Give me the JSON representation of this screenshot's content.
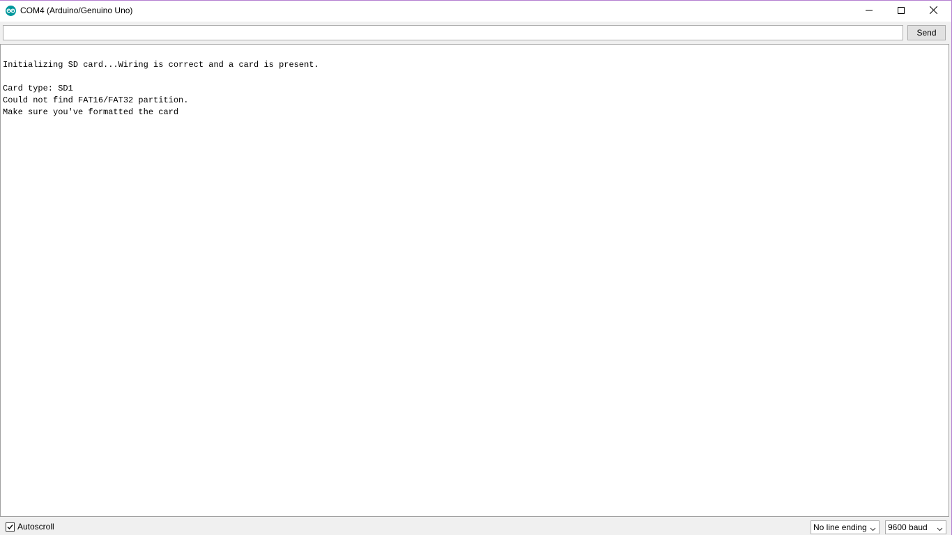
{
  "window": {
    "title": "COM4 (Arduino/Genuino Uno)",
    "icon": "arduino-icon",
    "controls": [
      "minimize-icon",
      "maximize-icon",
      "close-icon"
    ]
  },
  "send": {
    "input_value": "",
    "button_label": "Send"
  },
  "output": {
    "lines": [
      "",
      "Initializing SD card...Wiring is correct and a card is present.",
      "",
      "Card type: SD1",
      "Could not find FAT16/FAT32 partition.",
      "Make sure you've formatted the card"
    ]
  },
  "footer": {
    "autoscroll_label": "Autoscroll",
    "autoscroll_checked": true,
    "line_ending": "No line ending",
    "baud_rate": "9600 baud"
  },
  "colors": {
    "arduino_teal": "#00979c",
    "window_border": "#b47fd1"
  }
}
